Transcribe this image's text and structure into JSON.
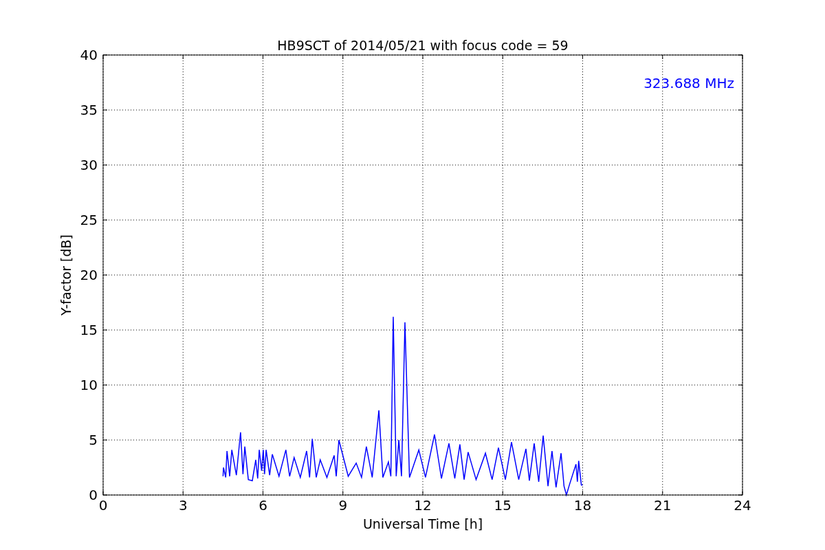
{
  "figure": {
    "chart_data": {
      "type": "line",
      "title": "HB9SCT of 2014/05/21 with focus code = 59",
      "xlabel": "Universal Time [h]",
      "ylabel": "Y-factor [dB]",
      "xlim": [
        0,
        24
      ],
      "ylim": [
        0,
        40
      ],
      "xticks": [
        0,
        3,
        6,
        9,
        12,
        15,
        18,
        21,
        24
      ],
      "yticks": [
        0,
        5,
        10,
        15,
        20,
        25,
        30,
        35,
        40
      ],
      "x": [
        4.5,
        4.52,
        4.6,
        4.65,
        4.75,
        4.83,
        5.0,
        5.16,
        5.25,
        5.32,
        5.45,
        5.6,
        5.73,
        5.8,
        5.86,
        5.95,
        6.01,
        6.06,
        6.12,
        6.25,
        6.35,
        6.6,
        6.86,
        7.0,
        7.17,
        7.4,
        7.64,
        7.75,
        7.85,
        8.0,
        8.15,
        8.4,
        8.67,
        8.75,
        8.85,
        9.2,
        9.5,
        9.7,
        9.88,
        10.1,
        10.35,
        10.5,
        10.71,
        10.8,
        10.89,
        11.0,
        11.1,
        11.2,
        11.33,
        11.5,
        11.85,
        12.1,
        12.44,
        12.7,
        12.98,
        13.2,
        13.39,
        13.55,
        13.7,
        14.0,
        14.35,
        14.6,
        14.84,
        15.1,
        15.33,
        15.6,
        15.87,
        16.0,
        16.18,
        16.35,
        16.52,
        16.7,
        16.85,
        17.0,
        17.19,
        17.3,
        17.39,
        17.5,
        17.75,
        17.8,
        17.85,
        17.95,
        18.0
      ],
      "series": [
        {
          "name": "323.688 MHz",
          "color": "#0000ff",
          "values": [
            1.7,
            2.5,
            1.6,
            4.0,
            1.7,
            4.1,
            1.8,
            5.7,
            1.9,
            4.4,
            1.4,
            1.3,
            3.2,
            1.5,
            4.1,
            2.2,
            4.1,
            1.9,
            4.1,
            1.8,
            3.7,
            1.7,
            4.1,
            1.7,
            3.4,
            1.6,
            4.0,
            1.6,
            5.1,
            1.6,
            3.2,
            1.6,
            3.6,
            1.7,
            5.0,
            1.7,
            2.9,
            1.6,
            4.4,
            1.6,
            7.7,
            1.6,
            3.0,
            1.7,
            16.2,
            1.7,
            5.0,
            1.7,
            15.7,
            1.6,
            4.1,
            1.6,
            5.5,
            1.5,
            4.7,
            1.5,
            4.6,
            1.4,
            3.9,
            1.4,
            3.8,
            1.4,
            4.3,
            1.4,
            4.8,
            1.4,
            4.2,
            1.3,
            4.7,
            1.2,
            5.4,
            0.8,
            4.0,
            0.7,
            3.8,
            0.8,
            0.0,
            0.9,
            2.8,
            1.2,
            3.1,
            0.9,
            0.9
          ]
        }
      ],
      "grid": true
    }
  }
}
